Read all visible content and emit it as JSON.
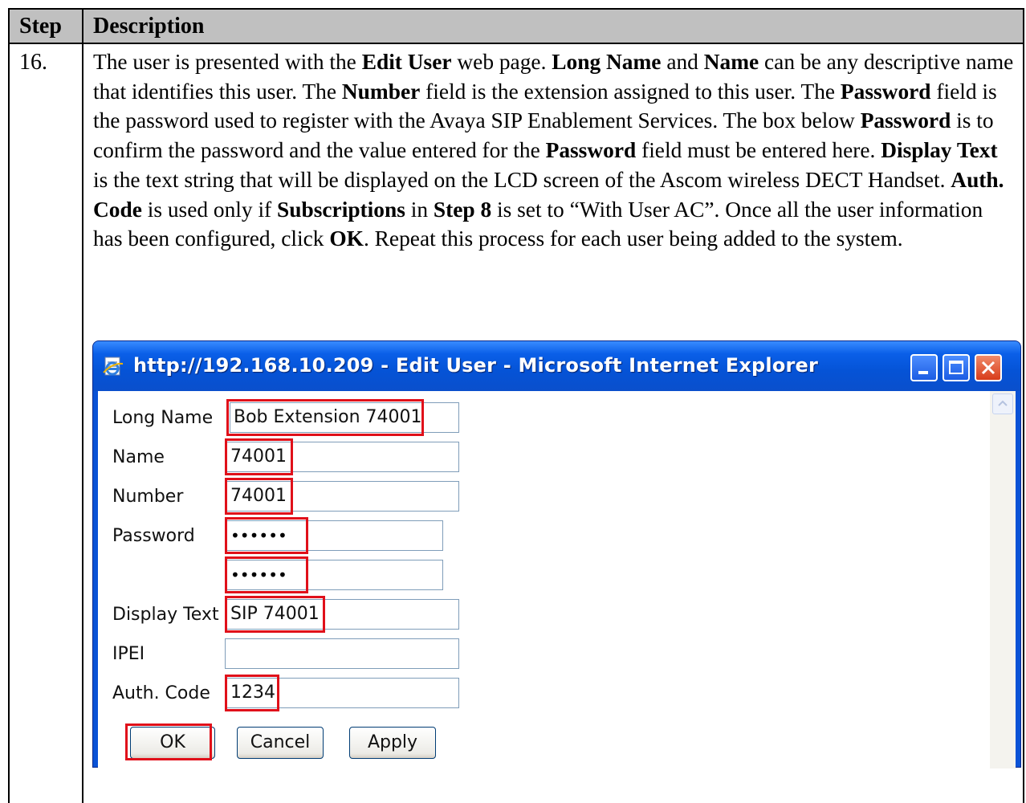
{
  "table": {
    "header_step": "Step",
    "header_description": "Description",
    "step_number": "16.",
    "description": [
      {
        "t": "The user is presented with the "
      },
      {
        "b": "Edit User"
      },
      {
        "t": " web page. "
      },
      {
        "b": "Long Name"
      },
      {
        "t": " and "
      },
      {
        "b": "Name"
      },
      {
        "t": " can be any descriptive name that identifies this user. The "
      },
      {
        "b": "Number"
      },
      {
        "t": " field is the extension assigned to this user. The "
      },
      {
        "b": "Password"
      },
      {
        "t": " field is the password used to register with the Avaya SIP Enablement Services. The box below "
      },
      {
        "b": "Password"
      },
      {
        "t": " is to confirm the password and the value entered for the "
      },
      {
        "b": "Password"
      },
      {
        "t": " field must be entered here. "
      },
      {
        "b": "Display Text"
      },
      {
        "t": " is the text string that will be displayed on the LCD screen of the Ascom wireless DECT Handset. "
      },
      {
        "b": "Auth. Code"
      },
      {
        "t": " is used only if "
      },
      {
        "b": "Subscriptions"
      },
      {
        "t": " in "
      },
      {
        "b": "Step 8"
      },
      {
        "t": " is set to “With User AC”. Once all the user information has been configured, click "
      },
      {
        "b": "OK"
      },
      {
        "t": ". Repeat this process for each user being added to the system."
      }
    ]
  },
  "window": {
    "title": "http://192.168.10.209 - Edit User - Microsoft Internet Explorer",
    "icon": "ie-page-icon"
  },
  "form": {
    "long_name_label": "Long Name",
    "long_name_value": "Bob Extension 74001",
    "name_label": "Name",
    "name_value": "74001",
    "number_label": "Number",
    "number_value": "74001",
    "password_label": "Password",
    "password_value": "••••••",
    "password_confirm_value": "••••••",
    "display_text_label": "Display Text",
    "display_text_value": "SIP 74001",
    "ipei_label": "IPEI",
    "ipei_value": "",
    "auth_code_label": "Auth. Code",
    "auth_code_value": "1234"
  },
  "buttons": {
    "ok": "OK",
    "cancel": "Cancel",
    "apply": "Apply"
  },
  "colors": {
    "highlight": "#e0101a",
    "titlebar": "#0553d6"
  }
}
